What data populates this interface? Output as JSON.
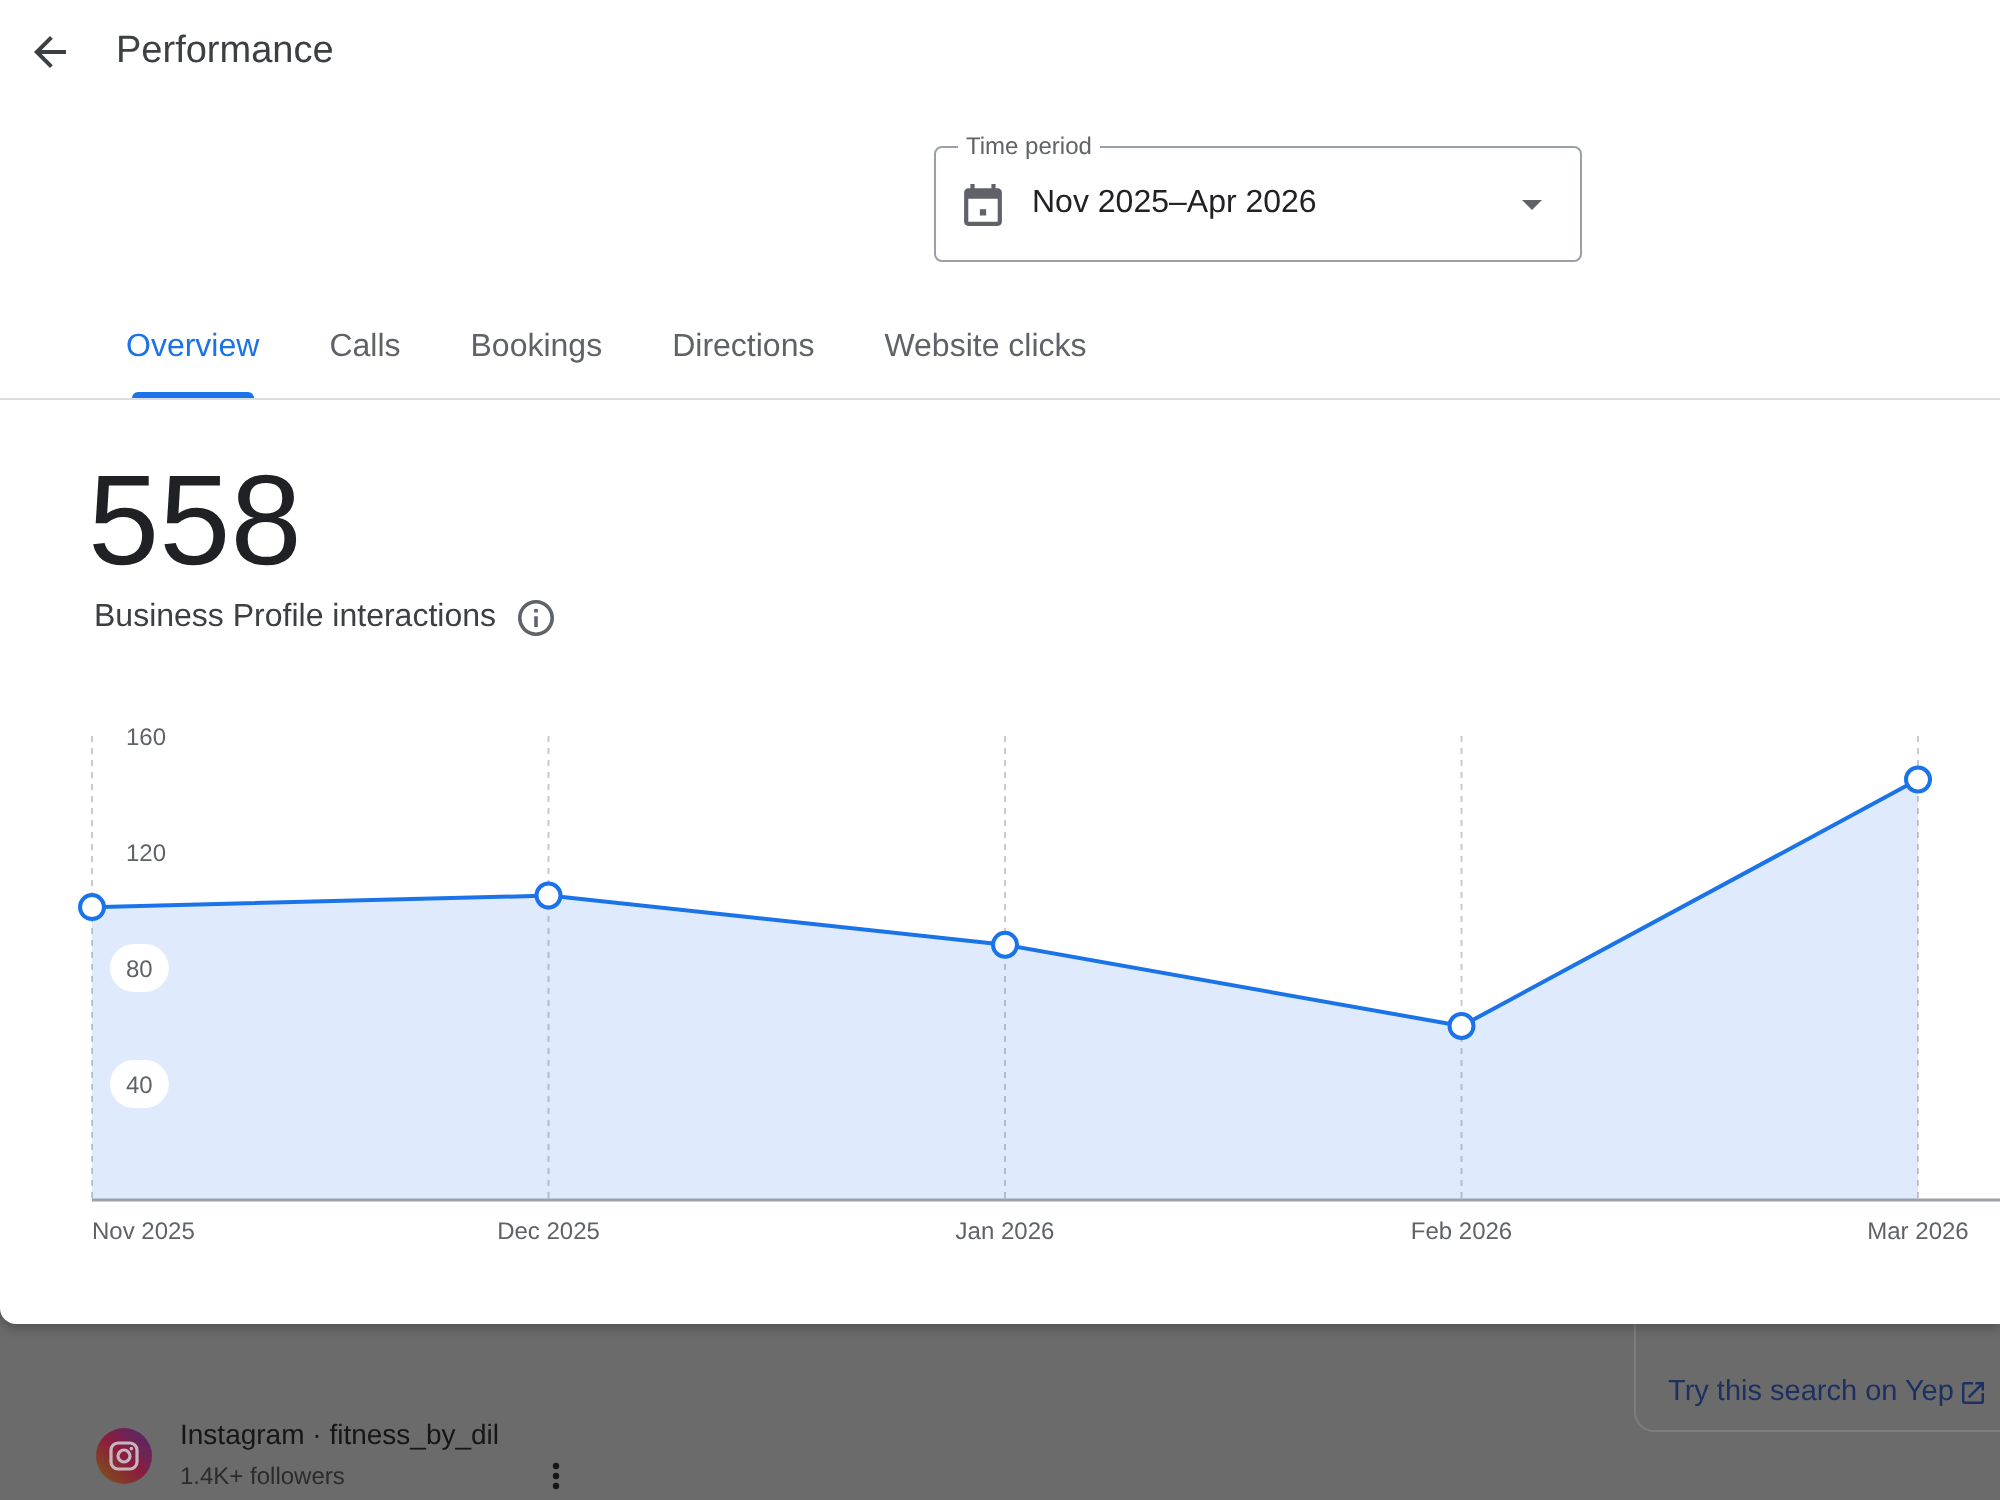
{
  "header": {
    "title": "Performance"
  },
  "time_period": {
    "label": "Time period",
    "value": "Nov 2025–Apr 2026"
  },
  "tabs": [
    {
      "label": "Overview",
      "selected": true
    },
    {
      "label": "Calls",
      "selected": false
    },
    {
      "label": "Bookings",
      "selected": false
    },
    {
      "label": "Directions",
      "selected": false
    },
    {
      "label": "Website clicks",
      "selected": false
    }
  ],
  "summary": {
    "value": "558",
    "label": "Business Profile interactions"
  },
  "chart": {
    "chart_data": {
      "type": "area",
      "grid": "x",
      "categories": [
        "Nov 2025",
        "Dec 2025",
        "Jan 2026",
        "Feb 2026",
        "Mar 2026"
      ],
      "series": [
        {
          "color": "#1a73e8",
          "values": [
            101,
            105,
            88,
            60,
            145
          ]
        }
      ],
      "ylim": [
        0,
        160
      ],
      "yticks": [
        40,
        80,
        120,
        160
      ]
    }
  },
  "background": {
    "search_card": {
      "link": "Try this search on Yep"
    },
    "result": {
      "title": "Instagram · fitness_by_dil",
      "subtitle": "1.4K+ followers"
    }
  }
}
